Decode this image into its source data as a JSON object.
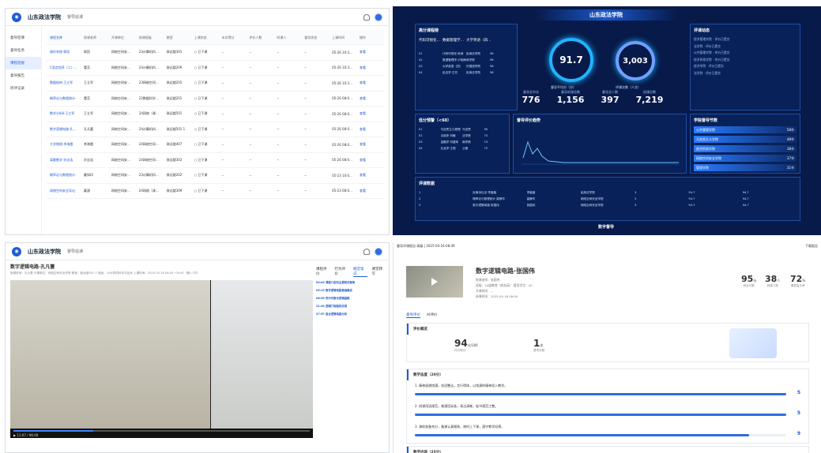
{
  "q1": {
    "school": "山东政法学院",
    "crumb": "督导巡课",
    "sidebar": [
      "督导巡课",
      "督导任务",
      "课程巡视",
      "督导报告",
      "听评记录"
    ],
    "headers": [
      "课程名称",
      "授课老师",
      "开课单位",
      "授课班级",
      "教室",
      "上课状态",
      "本次得分",
      "评价人数",
      "听课人",
      "督导状态",
      "上课时间",
      "操作"
    ],
    "rows": [
      [
        "操作系统·郭凯",
        "郭凯",
        "网络空间安全学院",
        "23计算机科学与",
        "致远楼301",
        "○ 已下课",
        "--",
        "--",
        "--",
        "--",
        "05-26 10:30~12:10",
        "查看"
      ],
      [
        "C语言程序（二）·董芳",
        "董芳",
        "网络空间安全学院",
        "24计算机科学与",
        "致远楼209",
        "○ 已下课",
        "--",
        "--",
        "--",
        "--",
        "05-26 10:30~12:10",
        "查看"
      ],
      [
        "数据结构·王立军",
        "王立军",
        "网络空间安全学院",
        "23网络空间安全",
        "致远楼205",
        "○ 已下课",
        "--",
        "--",
        "--",
        "--",
        "05-26 10:30~11:40",
        "查看"
      ],
      [
        "概率论与数理统计·",
        "董芳",
        "网络空间安全学院",
        "22数据科学与大",
        "致远楼201",
        "○ 已下课",
        "--",
        "--",
        "--",
        "--",
        "05-26 08:00~09:40",
        "查看"
      ],
      [
        "数学分析Ⅱ·王立军",
        "王立军",
        "网络空间安全学院",
        "24网络（课程）",
        "致远楼501",
        "○ 已下课",
        "--",
        "--",
        "--",
        "--",
        "05-26 08:00~09:40",
        "查看"
      ],
      [
        "数字逻辑电路·孔凡蕾",
        "孔凡蕾",
        "网络空间安全学院",
        "24计算机科学与",
        "致远楼501 1",
        "○ 已下课",
        "--",
        "--",
        "--",
        "--",
        "05-26 08:00~09:40",
        "查看"
      ],
      [
        "大学物理·李海霞",
        "李海霞",
        "网络空间安全学院",
        "24网络空间安全",
        "致远楼407",
        "○ 已下课",
        "--",
        "--",
        "--",
        "--",
        "05-26 08:00~09:40",
        "查看"
      ],
      [
        "离散数学·孙志浩",
        "孙志浩",
        "网络空间安全学院",
        "24网络空间安全",
        "致远楼303",
        "○ 已下课",
        "--",
        "--",
        "--",
        "--",
        "05-26 08:00~09:40",
        "查看"
      ],
      [
        "概率论与数理统计·",
        "戴如印",
        "网络空间安全学院",
        "23计算机科学与",
        "致远楼202",
        "○ 已下课",
        "--",
        "--",
        "--",
        "--",
        "05-23 10:00~11:40",
        "查看"
      ],
      [
        "网络空间安全导论·",
        "戴源",
        "网络空间安全学院",
        "24网络（课程）",
        "致远楼309",
        "○ 已下课",
        "--",
        "--",
        "--",
        "--",
        "05-23 08:00~09:40",
        "查看"
      ]
    ]
  },
  "q2": {
    "title": "山东政法学院",
    "panel_low": "高分课程榜",
    "panel_trend": "督导评价趋势",
    "panel_rec": "评课数据",
    "panel_dyn": "评课动态",
    "panel_rank": "学院督导节数",
    "panel_warn": "低分预警（<60）",
    "gauge1": "91.7",
    "gauge1_label": "督导平均分（分）",
    "gauge2": "3,003",
    "gauge2_label": "评课次数（人次）",
    "stats": [
      {
        "v": "776",
        "l": "督导总节次"
      },
      {
        "v": "1,156",
        "l": "督导听课总数"
      },
      {
        "v": "397",
        "l": "督导总人数"
      },
      {
        "v": "7,219",
        "l": "巡课总数"
      }
    ],
    "top3": [
      "代码可视化…",
      "数据管理学…",
      "大学英语（四…"
    ],
    "ranks": [
      {
        "n": "公共管理学院",
        "v": "58节"
      },
      {
        "n": "马克思主义学院",
        "v": "48节"
      },
      {
        "n": "经济贸易学院",
        "v": "38节"
      },
      {
        "n": "网络空间安全学院",
        "v": "37节"
      },
      {
        "n": "管理学院",
        "v": "31节"
      }
    ],
    "dyn": [
      "经济管理学院 · 评价已提交",
      "法学院 · 评价已提交",
      "公共管理学院 · 评价已提交",
      "经济贸易学院 · 评价已提交",
      "经济学院 · 评价已提交",
      "法学院 · 评价已提交"
    ],
    "rec": [
      [
        "1",
        "民事诉讼法·李馨馨",
        "李馨馨",
        "民商法学院",
        "3",
        "94.7",
        "94.7"
      ],
      [
        "2",
        "概率论与数理统计·高静华",
        "高静华",
        "网络空间安全学院",
        "5",
        "94.7",
        "94.7"
      ],
      [
        "3",
        "数字逻辑电路·张国伟",
        "张国伟",
        "网络空间安全学院",
        "5",
        "94.7",
        "94.7"
      ]
    ],
    "footer": "数字督导"
  },
  "q3": {
    "school": "山东政法学院",
    "crumb": "督导巡课",
    "title": "数字逻辑电路·孔凡蕾",
    "meta": "授课老师：孔凡蕾  开课单位：网络空间安全学院  教室：致远楼501 1  班级：24计算机科学与技术  上课时间：2025-05-26 08:00~09:40（第1-2节）",
    "tabs": [
      "课程评价",
      "行为评价",
      "随堂笔记",
      "课堂转写"
    ],
    "notes": [
      {
        "t": "00:02",
        "h": "课程介绍与主要知识框架"
      },
      {
        "t": "05:13",
        "h": "数字逻辑电路基础概念"
      },
      {
        "t": "08:55",
        "h": "布尔代数与逻辑函数"
      },
      {
        "t": "21:30",
        "h": "逻辑门电路的实现"
      },
      {
        "t": "27:57",
        "h": "组合逻辑电路分析"
      }
    ],
    "time": "11:07 / 96:00"
  },
  "q4": {
    "top": "督导评课报告-高级 | 2025-04-16-08:49",
    "download": "下载报告",
    "title": "数字逻辑电路·张国伟",
    "meta": [
      "授课老师：张国伟",
      "班级：24级教育（商务英）   督导学生：40",
      "开课时间：--",
      "授课时间：2025-04-16 08:00"
    ],
    "kpis": [
      {
        "v": "95",
        "u": "分",
        "l": "综合分数"
      },
      {
        "v": "38",
        "u": "人",
        "l": "到课人数"
      },
      {
        "v": "72",
        "u": "%",
        "l": "课堂抬头率"
      }
    ],
    "tabs": [
      "督导评价",
      "AI评价"
    ],
    "overview": "评价概览",
    "score": "94",
    "score_unit": "分/100",
    "score_label": "评价得分",
    "cnt": "1",
    "cnt_unit": "次",
    "cnt_label": "督导次数",
    "sec1": "教学态度（20分）",
    "items": [
      {
        "t": "1. 精神面貌饱满，衣冠整洁，言行得体，以饱满的精神投入教学。",
        "s": "5",
        "p": 1.0
      },
      {
        "t": "2. 授课用语规范，普通话标准，表达清晰，板书规范工整。",
        "s": "5",
        "p": 1.0
      },
      {
        "t": "3. 课前准备充分，备课认真细致，按时上下课，遵守教学纪律。",
        "s": "9",
        "p": 0.9
      }
    ],
    "sec2": "教学内容（25分）"
  }
}
